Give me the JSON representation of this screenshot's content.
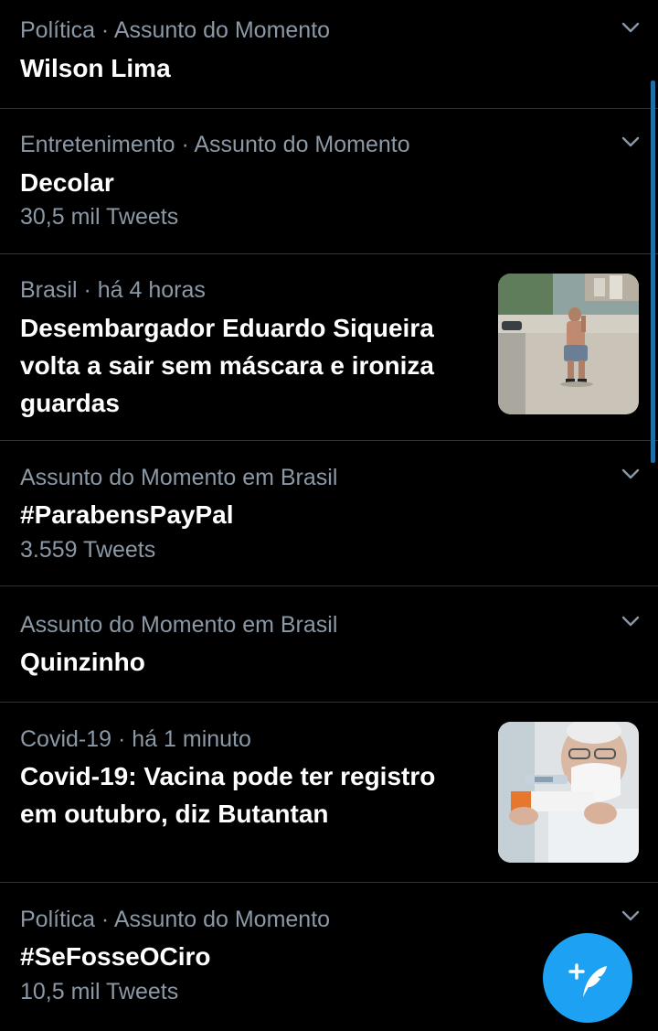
{
  "trends": [
    {
      "meta": "Política · Assunto do Momento",
      "title": "Wilson Lima",
      "count": ""
    },
    {
      "meta": "Entretenimento · Assunto do Momento",
      "title": "Decolar",
      "count": "30,5 mil Tweets"
    },
    {
      "meta": "Brasil · há 4 horas",
      "title": "Desembargador Eduardo Siqueira volta a sair sem máscara e ironiza guardas",
      "count": ""
    },
    {
      "meta": "Assunto do Momento em Brasil",
      "title": "#ParabensPayPal",
      "count": "3.559 Tweets"
    },
    {
      "meta": "Assunto do Momento em Brasil",
      "title": "Quinzinho",
      "count": ""
    },
    {
      "meta": "Covid-19 · há 1 minuto",
      "title": "Covid-19: Vacina pode ter registro em outubro, diz Butantan",
      "count": ""
    },
    {
      "meta": "Política · Assunto do Momento",
      "title": "#SeFosseOCiro",
      "count": "10,5 mil Tweets"
    }
  ],
  "icons": {
    "more": "chevron-down-icon",
    "compose": "compose-tweet-icon"
  },
  "colors": {
    "background": "#000000",
    "secondary_text": "#8b98a5",
    "accent": "#1da1f2"
  }
}
